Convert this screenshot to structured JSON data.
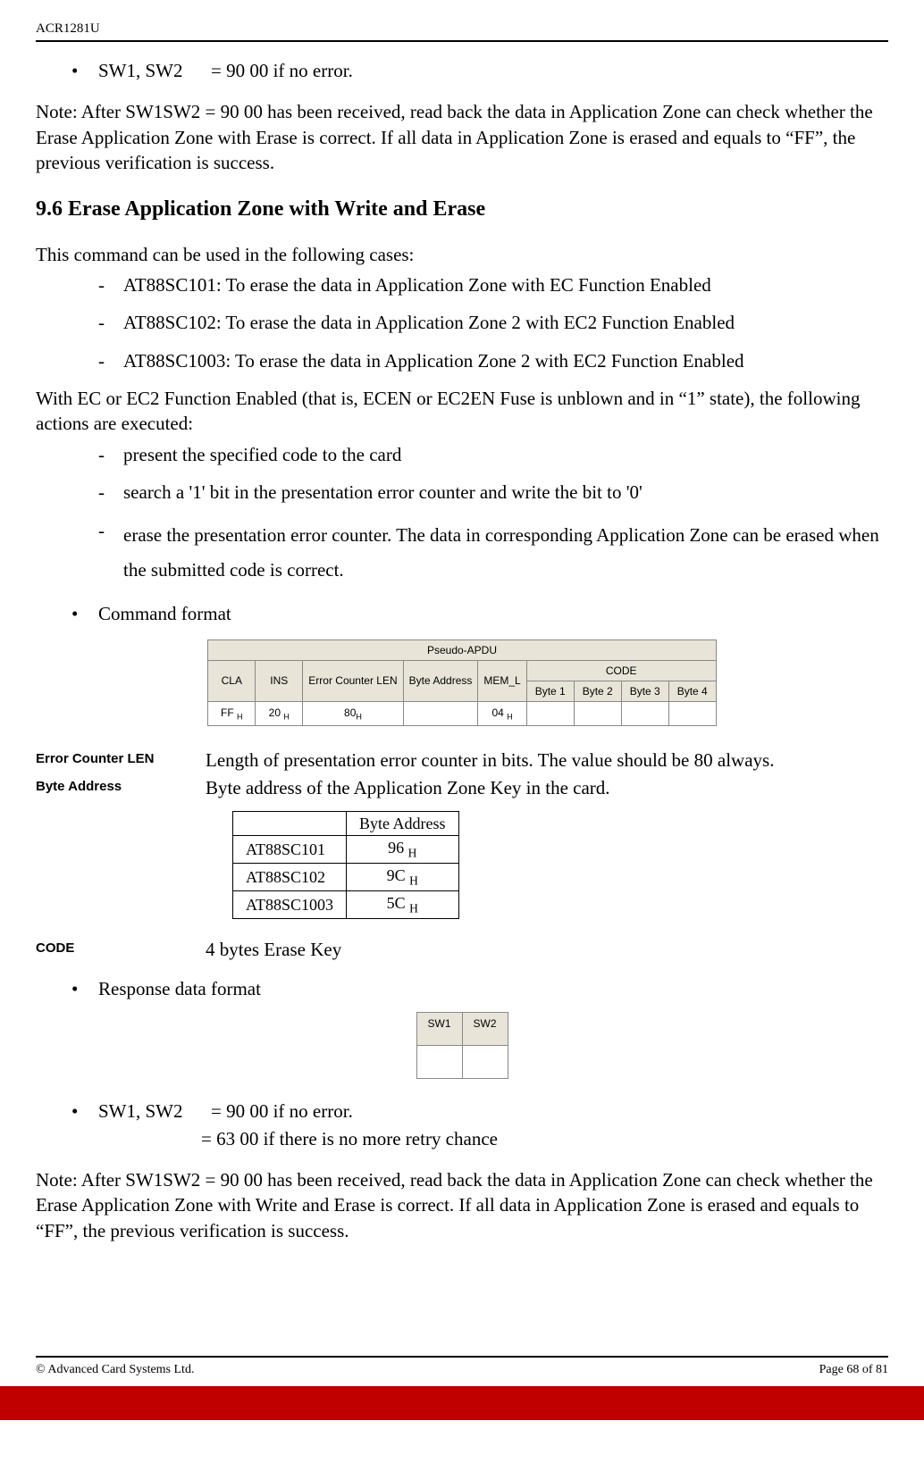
{
  "doc_header": "ACR1281U",
  "sw_bullet_prefix": "SW1, SW2",
  "sw_bullet_suffix": "= 90 00 if no error.",
  "note1": "Note:  After SW1SW2 = 90 00 has been received, read back the data in Application Zone can check whether the Erase Application Zone with Erase is correct.  If all data in Application Zone is erased and equals to “FF”, the previous verification is success.",
  "section_title": "9.6 Erase Application Zone with Write and Erase",
  "cases_intro": "This command can be used in the following cases:",
  "cases": [
    "AT88SC101: To erase the data in Application Zone with EC Function Enabled",
    "AT88SC102: To erase the data in Application Zone 2 with EC2 Function Enabled",
    "AT88SC1003: To erase the data in Application Zone 2 with EC2 Function Enabled"
  ],
  "ec_intro": "With EC or EC2 Function Enabled (that is, ECEN or EC2EN Fuse is unblown and in “1” state), the following actions are executed:",
  "actions": [
    "present the specified code to the card",
    "search a '1' bit in the presentation error counter and write the bit to '0'",
    "erase the presentation error counter.  The data in corresponding Application Zone can be erased when the submitted code is correct."
  ],
  "cmd_format_label": "Command format",
  "apdu": {
    "header": "Pseudo-APDU",
    "c_cla": "CLA",
    "c_ins": "INS",
    "c_ecl": "Error Counter LEN",
    "c_ba": "Byte Address",
    "c_mem": "MEM_L",
    "c_code": "CODE",
    "c_b1": "Byte 1",
    "c_b2": "Byte 2",
    "c_b3": "Byte 3",
    "c_b4": "Byte 4",
    "v_cla": "FF",
    "v_ins": "20",
    "v_ecl": "80",
    "v_mem": "04"
  },
  "def_ecl_label": "Error Counter LEN",
  "def_ecl_text": "Length of presentation error counter in bits.  The value should be 80 always.",
  "def_ba_label": "Byte Address",
  "def_ba_text": "Byte address of the Application Zone Key in the card.",
  "ba_table": {
    "hdr_blank": "",
    "hdr_ba": "Byte Address",
    "rows": [
      {
        "name": "AT88SC101",
        "val": "96"
      },
      {
        "name": "AT88SC102",
        "val": "9C"
      },
      {
        "name": "AT88SC1003",
        "val": "5C"
      }
    ]
  },
  "def_code_label": "CODE",
  "def_code_text": "4 bytes Erase Key",
  "resp_format_label": "Response data format",
  "sw_headers": {
    "sw1": "SW1",
    "sw2": "SW2"
  },
  "sw_results": {
    "prefix": "SW1, SW2",
    "line1": "= 90 00 if no error.",
    "line2": "= 63 00 if there is no more retry chance"
  },
  "note2": "Note:  After SW1SW2 = 90 00 has been received, read back the data in Application Zone can check whether the Erase Application Zone with Write and Erase is correct.  If all data in Application Zone is erased and equals to “FF”, the previous verification is success.",
  "footer_left": "© Advanced Card Systems Ltd.",
  "footer_right": "Page 68 of 81",
  "sub_H": "H"
}
